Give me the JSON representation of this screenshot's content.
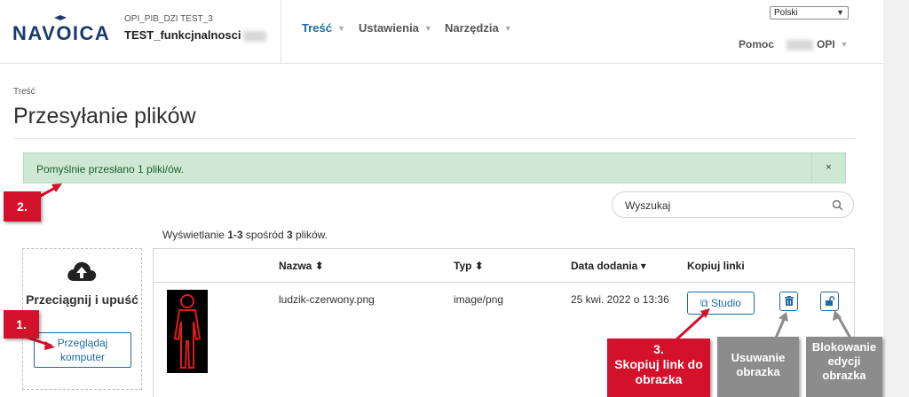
{
  "header": {
    "logo_text": "NAVOICA",
    "course_org": "OPI_PIB_DZI TEST_3",
    "course_name": "TEST_funkcjnalnosci",
    "nav": [
      {
        "label": "Treść",
        "active": true
      },
      {
        "label": "Ustawienia",
        "active": false
      },
      {
        "label": "Narzędzia",
        "active": false
      }
    ],
    "language_selected": "Polski",
    "help_label": "Pomoc",
    "user_label": "OPI"
  },
  "page": {
    "breadcrumb": "Treść",
    "title": "Przesyłanie plików"
  },
  "alert": {
    "message": "Pomyślnie przesłano 1 pliki/ów.",
    "close_label": "×"
  },
  "search": {
    "placeholder": "Wyszukaj"
  },
  "summary": {
    "prefix": "Wyświetlanie ",
    "range": "1-3",
    "middle": " spośród ",
    "total": "3",
    "suffix": " plików."
  },
  "upload": {
    "drop_label": "Przeciągnij i upuść",
    "browse_label": "Przeglądaj komputer"
  },
  "table": {
    "columns": [
      "Nazwa",
      "Typ",
      "Data dodania",
      "Kopiuj linki"
    ],
    "rows": [
      {
        "name": "ludzik-czerwony.png",
        "type": "image/png",
        "date": "25 kwi. 2022 o 13:36",
        "copy_label": "Studio"
      }
    ]
  },
  "annotations": {
    "step1": "1.",
    "step2": "2.",
    "step3_num": "3.",
    "step3_text": "Skopiuj link do obrazka",
    "delete_text": "Usuwanie obrazka",
    "lock_text": "Blokowanie edycji obrazka"
  },
  "colors": {
    "brand": "#1a3a6b",
    "link": "#1d6aa5",
    "alert_bg": "#cfe8d3",
    "annotation_red": "#d3112a",
    "annotation_gray": "#8c8c8c"
  }
}
